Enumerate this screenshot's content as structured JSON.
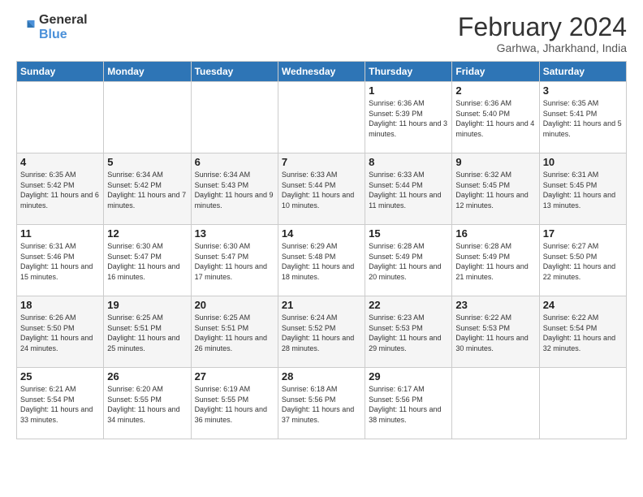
{
  "logo": {
    "line1": "General",
    "line2": "Blue"
  },
  "title": "February 2024",
  "subtitle": "Garhwa, Jharkhand, India",
  "weekdays": [
    "Sunday",
    "Monday",
    "Tuesday",
    "Wednesday",
    "Thursday",
    "Friday",
    "Saturday"
  ],
  "weeks": [
    [
      {
        "day": "",
        "info": ""
      },
      {
        "day": "",
        "info": ""
      },
      {
        "day": "",
        "info": ""
      },
      {
        "day": "",
        "info": ""
      },
      {
        "day": "1",
        "info": "Sunrise: 6:36 AM\nSunset: 5:39 PM\nDaylight: 11 hours and 3 minutes."
      },
      {
        "day": "2",
        "info": "Sunrise: 6:36 AM\nSunset: 5:40 PM\nDaylight: 11 hours and 4 minutes."
      },
      {
        "day": "3",
        "info": "Sunrise: 6:35 AM\nSunset: 5:41 PM\nDaylight: 11 hours and 5 minutes."
      }
    ],
    [
      {
        "day": "4",
        "info": "Sunrise: 6:35 AM\nSunset: 5:42 PM\nDaylight: 11 hours and 6 minutes."
      },
      {
        "day": "5",
        "info": "Sunrise: 6:34 AM\nSunset: 5:42 PM\nDaylight: 11 hours and 7 minutes."
      },
      {
        "day": "6",
        "info": "Sunrise: 6:34 AM\nSunset: 5:43 PM\nDaylight: 11 hours and 9 minutes."
      },
      {
        "day": "7",
        "info": "Sunrise: 6:33 AM\nSunset: 5:44 PM\nDaylight: 11 hours and 10 minutes."
      },
      {
        "day": "8",
        "info": "Sunrise: 6:33 AM\nSunset: 5:44 PM\nDaylight: 11 hours and 11 minutes."
      },
      {
        "day": "9",
        "info": "Sunrise: 6:32 AM\nSunset: 5:45 PM\nDaylight: 11 hours and 12 minutes."
      },
      {
        "day": "10",
        "info": "Sunrise: 6:31 AM\nSunset: 5:45 PM\nDaylight: 11 hours and 13 minutes."
      }
    ],
    [
      {
        "day": "11",
        "info": "Sunrise: 6:31 AM\nSunset: 5:46 PM\nDaylight: 11 hours and 15 minutes."
      },
      {
        "day": "12",
        "info": "Sunrise: 6:30 AM\nSunset: 5:47 PM\nDaylight: 11 hours and 16 minutes."
      },
      {
        "day": "13",
        "info": "Sunrise: 6:30 AM\nSunset: 5:47 PM\nDaylight: 11 hours and 17 minutes."
      },
      {
        "day": "14",
        "info": "Sunrise: 6:29 AM\nSunset: 5:48 PM\nDaylight: 11 hours and 18 minutes."
      },
      {
        "day": "15",
        "info": "Sunrise: 6:28 AM\nSunset: 5:49 PM\nDaylight: 11 hours and 20 minutes."
      },
      {
        "day": "16",
        "info": "Sunrise: 6:28 AM\nSunset: 5:49 PM\nDaylight: 11 hours and 21 minutes."
      },
      {
        "day": "17",
        "info": "Sunrise: 6:27 AM\nSunset: 5:50 PM\nDaylight: 11 hours and 22 minutes."
      }
    ],
    [
      {
        "day": "18",
        "info": "Sunrise: 6:26 AM\nSunset: 5:50 PM\nDaylight: 11 hours and 24 minutes."
      },
      {
        "day": "19",
        "info": "Sunrise: 6:25 AM\nSunset: 5:51 PM\nDaylight: 11 hours and 25 minutes."
      },
      {
        "day": "20",
        "info": "Sunrise: 6:25 AM\nSunset: 5:51 PM\nDaylight: 11 hours and 26 minutes."
      },
      {
        "day": "21",
        "info": "Sunrise: 6:24 AM\nSunset: 5:52 PM\nDaylight: 11 hours and 28 minutes."
      },
      {
        "day": "22",
        "info": "Sunrise: 6:23 AM\nSunset: 5:53 PM\nDaylight: 11 hours and 29 minutes."
      },
      {
        "day": "23",
        "info": "Sunrise: 6:22 AM\nSunset: 5:53 PM\nDaylight: 11 hours and 30 minutes."
      },
      {
        "day": "24",
        "info": "Sunrise: 6:22 AM\nSunset: 5:54 PM\nDaylight: 11 hours and 32 minutes."
      }
    ],
    [
      {
        "day": "25",
        "info": "Sunrise: 6:21 AM\nSunset: 5:54 PM\nDaylight: 11 hours and 33 minutes."
      },
      {
        "day": "26",
        "info": "Sunrise: 6:20 AM\nSunset: 5:55 PM\nDaylight: 11 hours and 34 minutes."
      },
      {
        "day": "27",
        "info": "Sunrise: 6:19 AM\nSunset: 5:55 PM\nDaylight: 11 hours and 36 minutes."
      },
      {
        "day": "28",
        "info": "Sunrise: 6:18 AM\nSunset: 5:56 PM\nDaylight: 11 hours and 37 minutes."
      },
      {
        "day": "29",
        "info": "Sunrise: 6:17 AM\nSunset: 5:56 PM\nDaylight: 11 hours and 38 minutes."
      },
      {
        "day": "",
        "info": ""
      },
      {
        "day": "",
        "info": ""
      }
    ]
  ]
}
